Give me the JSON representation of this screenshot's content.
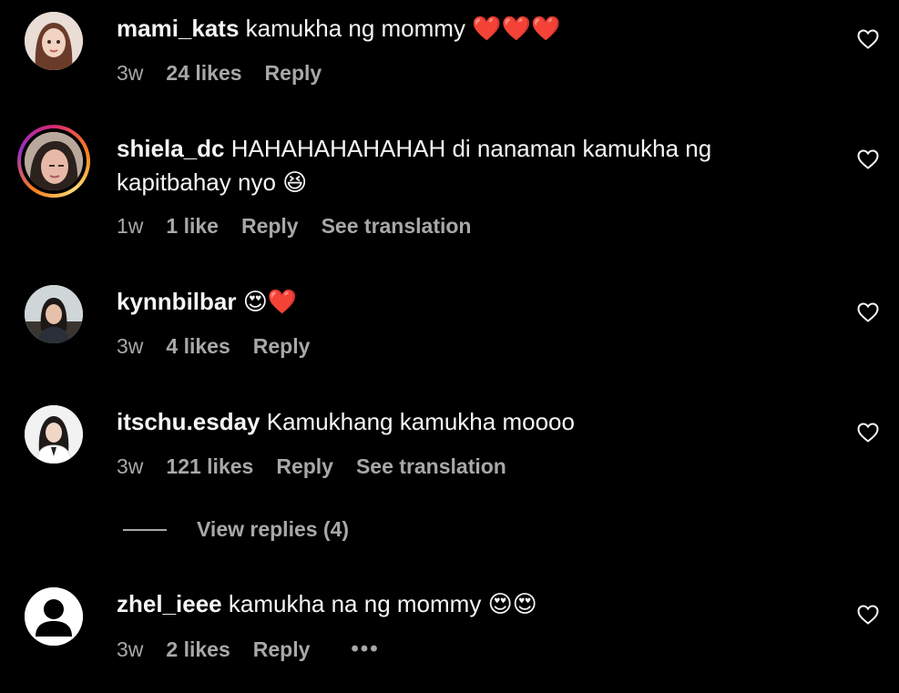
{
  "comments": [
    {
      "username": "mami_kats",
      "text": "kamukha ng mommy",
      "emoji": "❤️❤️❤️",
      "time": "3w",
      "likes": "24 likes",
      "reply": "Reply"
    },
    {
      "username": "shiela_dc",
      "text": "HAHAHAHAHAHAH di nanaman kamukha ng kapitbahay nyo",
      "emoji": "😆",
      "time": "1w",
      "likes": "1 like",
      "reply": "Reply",
      "translate": "See translation"
    },
    {
      "username": "kynnbilbar",
      "text": "",
      "emoji": "😍❤️",
      "time": "3w",
      "likes": "4 likes",
      "reply": "Reply"
    },
    {
      "username": "itschu.esday",
      "text": "Kamukhang kamukha moooo",
      "emoji": "",
      "time": "3w",
      "likes": "121 likes",
      "reply": "Reply",
      "translate": "See translation"
    },
    {
      "username": "zhel_ieee",
      "text": "kamukha na ng mommy",
      "emoji": "😍😍",
      "time": "3w",
      "likes": "2 likes",
      "reply": "Reply",
      "more": "•••"
    }
  ],
  "view_replies": "View replies (4)",
  "colors": {
    "background": "#000000",
    "text": "#f5f5f5",
    "meta": "#a8a8a8"
  },
  "icons": [
    "heart-outline-icon",
    "more-options-icon",
    "default-avatar-icon"
  ]
}
